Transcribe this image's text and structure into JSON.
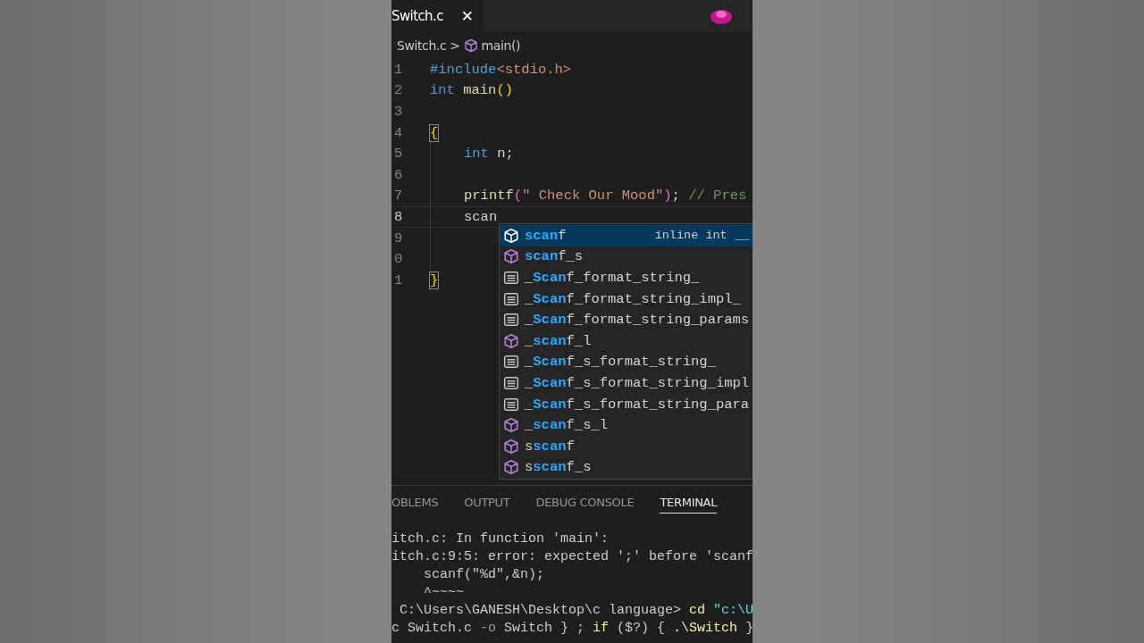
{
  "tab": {
    "label": "Switch.c",
    "close": "✕"
  },
  "breadcrumb": {
    "file": "Switch.c",
    "separator": ">",
    "symbol": "main()"
  },
  "code_lines": [
    {
      "number": "1",
      "current": false,
      "guide": false,
      "segments": [
        {
          "kind": "keyword",
          "text": "#include"
        },
        {
          "kind": "string",
          "text": "<stdio.h>"
        }
      ]
    },
    {
      "number": "2",
      "current": false,
      "guide": false,
      "segments": [
        {
          "kind": "keyword",
          "text": "int"
        },
        {
          "kind": "func",
          "text": " main"
        },
        {
          "kind": "paren",
          "text": "()"
        }
      ]
    },
    {
      "number": "3",
      "current": false,
      "guide": false
    },
    {
      "number": "4",
      "current": false,
      "guide": false,
      "segments": [
        {
          "kind": "bracket",
          "text": "{"
        }
      ]
    },
    {
      "number": "5",
      "current": false,
      "guide": true,
      "segments": [
        {
          "kind": "keyword",
          "text": "int"
        },
        {
          "kind": "plain",
          "text": " n;"
        }
      ]
    },
    {
      "number": "6",
      "current": false,
      "guide": true
    },
    {
      "number": "7",
      "current": false,
      "guide": true,
      "segments": [
        {
          "kind": "func",
          "text": "printf"
        },
        {
          "kind": "paren2",
          "text": "("
        },
        {
          "kind": "string",
          "text": "\" Check Our Mood\""
        },
        {
          "kind": "paren2",
          "text": ")"
        },
        {
          "kind": "plain",
          "text": "; "
        },
        {
          "kind": "comment",
          "text": "// Pres"
        }
      ]
    },
    {
      "number": "8",
      "current": true,
      "guide": true,
      "segments": [
        {
          "kind": "plain",
          "text": "scan"
        }
      ]
    },
    {
      "number": "9",
      "current": false,
      "guide": true
    },
    {
      "number": "0",
      "current": false,
      "guide": true
    },
    {
      "number": "1",
      "current": false,
      "guide": false,
      "segments": [
        {
          "kind": "bracket",
          "text": "}"
        }
      ]
    }
  ],
  "suggestions": [
    {
      "kind": "function",
      "selected": true,
      "match": "scan",
      "rest": "f",
      "detail": "inline int __"
    },
    {
      "kind": "function",
      "selected": false,
      "match": "scan",
      "rest": "f_s"
    },
    {
      "kind": "text",
      "selected": false,
      "prefix": "_",
      "match": "Scan",
      "rest": "f_format_string_"
    },
    {
      "kind": "text",
      "selected": false,
      "prefix": "_",
      "match": "Scan",
      "rest": "f_format_string_impl_"
    },
    {
      "kind": "text",
      "selected": false,
      "prefix": "_",
      "match": "Scan",
      "rest": "f_format_string_params"
    },
    {
      "kind": "function",
      "selected": false,
      "prefix": "_",
      "match": "scan",
      "rest": "f_l"
    },
    {
      "kind": "text",
      "selected": false,
      "prefix": "_",
      "match": "Scan",
      "rest": "f_s_format_string_"
    },
    {
      "kind": "text",
      "selected": false,
      "prefix": "_",
      "match": "Scan",
      "rest": "f_s_format_string_impl"
    },
    {
      "kind": "text",
      "selected": false,
      "prefix": "_",
      "match": "Scan",
      "rest": "f_s_format_string_para"
    },
    {
      "kind": "function",
      "selected": false,
      "prefix": "_",
      "match": "scan",
      "rest": "f_s_l"
    },
    {
      "kind": "function",
      "selected": false,
      "prefix": "s",
      "match": "scan",
      "rest": "f"
    },
    {
      "kind": "function",
      "selected": false,
      "prefix": "s",
      "match": "scan",
      "rest": "f_s"
    }
  ],
  "panel_tabs": [
    {
      "label": "OBLEMS",
      "selected": false
    },
    {
      "label": "OUTPUT",
      "selected": false
    },
    {
      "label": "DEBUG CONSOLE",
      "selected": false
    },
    {
      "label": "TERMINAL",
      "selected": true
    }
  ],
  "terminal_lines": [
    [
      {
        "kind": "plain",
        "text": "itch.c: In function 'main':"
      }
    ],
    [
      {
        "kind": "plain",
        "text": "itch.c:9:5: error: expected ';' before 'scanf"
      }
    ],
    [
      {
        "kind": "plain",
        "text": "    scanf(\"%d\",&n);"
      }
    ],
    [
      {
        "kind": "plain",
        "text": "    ^~~~~"
      }
    ],
    [
      {
        "kind": "plain",
        "text": " C:\\Users\\GANESH\\Desktop\\c language> "
      },
      {
        "kind": "command",
        "text": "cd"
      },
      {
        "kind": "string",
        "text": " \"c:\\U"
      }
    ],
    [
      {
        "kind": "plain",
        "text": "c Switch.c "
      },
      {
        "kind": "option",
        "text": "-o"
      },
      {
        "kind": "plain",
        "text": " Switch } ; "
      },
      {
        "kind": "command",
        "text": "if"
      },
      {
        "kind": "plain",
        "text": " ($?) { "
      },
      {
        "kind": "command",
        "text": ".\\Switch"
      },
      {
        "kind": "plain",
        "text": " }"
      }
    ]
  ]
}
